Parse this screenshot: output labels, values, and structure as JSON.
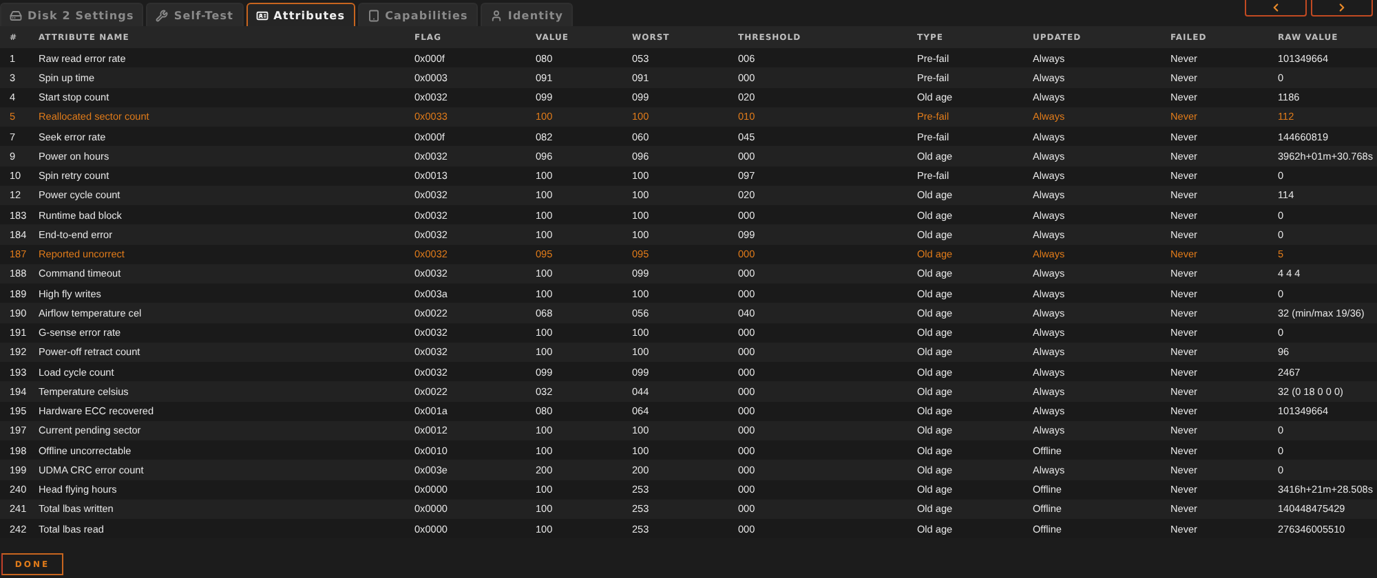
{
  "tabs": [
    {
      "label": "Disk 2 Settings",
      "selected": false
    },
    {
      "label": "Self-Test",
      "selected": false
    },
    {
      "label": "Attributes",
      "selected": true
    },
    {
      "label": "Capabilities",
      "selected": false
    },
    {
      "label": "Identity",
      "selected": false
    }
  ],
  "table": {
    "columns": [
      "#",
      "ATTRIBUTE NAME",
      "FLAG",
      "VALUE",
      "WORST",
      "THRESHOLD",
      "TYPE",
      "UPDATED",
      "FAILED",
      "RAW VALUE"
    ],
    "rows": [
      {
        "cells": [
          "1",
          "Raw read error rate",
          "0x000f",
          "080",
          "053",
          "006",
          "Pre-fail",
          "Always",
          "Never",
          "101349664"
        ],
        "warning": false
      },
      {
        "cells": [
          "3",
          "Spin up time",
          "0x0003",
          "091",
          "091",
          "000",
          "Pre-fail",
          "Always",
          "Never",
          "0"
        ],
        "warning": false
      },
      {
        "cells": [
          "4",
          "Start stop count",
          "0x0032",
          "099",
          "099",
          "020",
          "Old age",
          "Always",
          "Never",
          "1186"
        ],
        "warning": false
      },
      {
        "cells": [
          "5",
          "Reallocated sector count",
          "0x0033",
          "100",
          "100",
          "010",
          "Pre-fail",
          "Always",
          "Never",
          "112"
        ],
        "warning": true
      },
      {
        "cells": [
          "7",
          "Seek error rate",
          "0x000f",
          "082",
          "060",
          "045",
          "Pre-fail",
          "Always",
          "Never",
          "144660819"
        ],
        "warning": false
      },
      {
        "cells": [
          "9",
          "Power on hours",
          "0x0032",
          "096",
          "096",
          "000",
          "Old age",
          "Always",
          "Never",
          "3962h+01m+30.768s"
        ],
        "warning": false
      },
      {
        "cells": [
          "10",
          "Spin retry count",
          "0x0013",
          "100",
          "100",
          "097",
          "Pre-fail",
          "Always",
          "Never",
          "0"
        ],
        "warning": false
      },
      {
        "cells": [
          "12",
          "Power cycle count",
          "0x0032",
          "100",
          "100",
          "020",
          "Old age",
          "Always",
          "Never",
          "114"
        ],
        "warning": false
      },
      {
        "cells": [
          "183",
          "Runtime bad block",
          "0x0032",
          "100",
          "100",
          "000",
          "Old age",
          "Always",
          "Never",
          "0"
        ],
        "warning": false
      },
      {
        "cells": [
          "184",
          "End-to-end error",
          "0x0032",
          "100",
          "100",
          "099",
          "Old age",
          "Always",
          "Never",
          "0"
        ],
        "warning": false
      },
      {
        "cells": [
          "187",
          "Reported uncorrect",
          "0x0032",
          "095",
          "095",
          "000",
          "Old age",
          "Always",
          "Never",
          "5"
        ],
        "warning": true
      },
      {
        "cells": [
          "188",
          "Command timeout",
          "0x0032",
          "100",
          "099",
          "000",
          "Old age",
          "Always",
          "Never",
          "4 4 4"
        ],
        "warning": false
      },
      {
        "cells": [
          "189",
          "High fly writes",
          "0x003a",
          "100",
          "100",
          "000",
          "Old age",
          "Always",
          "Never",
          "0"
        ],
        "warning": false
      },
      {
        "cells": [
          "190",
          "Airflow temperature cel",
          "0x0022",
          "068",
          "056",
          "040",
          "Old age",
          "Always",
          "Never",
          "32 (min/max 19/36)"
        ],
        "warning": false
      },
      {
        "cells": [
          "191",
          "G-sense error rate",
          "0x0032",
          "100",
          "100",
          "000",
          "Old age",
          "Always",
          "Never",
          "0"
        ],
        "warning": false
      },
      {
        "cells": [
          "192",
          "Power-off retract count",
          "0x0032",
          "100",
          "100",
          "000",
          "Old age",
          "Always",
          "Never",
          "96"
        ],
        "warning": false
      },
      {
        "cells": [
          "193",
          "Load cycle count",
          "0x0032",
          "099",
          "099",
          "000",
          "Old age",
          "Always",
          "Never",
          "2467"
        ],
        "warning": false
      },
      {
        "cells": [
          "194",
          "Temperature celsius",
          "0x0022",
          "032",
          "044",
          "000",
          "Old age",
          "Always",
          "Never",
          "32 (0 18 0 0 0)"
        ],
        "warning": false
      },
      {
        "cells": [
          "195",
          "Hardware ECC recovered",
          "0x001a",
          "080",
          "064",
          "000",
          "Old age",
          "Always",
          "Never",
          "101349664"
        ],
        "warning": false
      },
      {
        "cells": [
          "197",
          "Current pending sector",
          "0x0012",
          "100",
          "100",
          "000",
          "Old age",
          "Always",
          "Never",
          "0"
        ],
        "warning": false
      },
      {
        "cells": [
          "198",
          "Offline uncorrectable",
          "0x0010",
          "100",
          "100",
          "000",
          "Old age",
          "Offline",
          "Never",
          "0"
        ],
        "warning": false
      },
      {
        "cells": [
          "199",
          "UDMA CRC error count",
          "0x003e",
          "200",
          "200",
          "000",
          "Old age",
          "Always",
          "Never",
          "0"
        ],
        "warning": false
      },
      {
        "cells": [
          "240",
          "Head flying hours",
          "0x0000",
          "100",
          "253",
          "000",
          "Old age",
          "Offline",
          "Never",
          "3416h+21m+28.508s"
        ],
        "warning": false
      },
      {
        "cells": [
          "241",
          "Total lbas written",
          "0x0000",
          "100",
          "253",
          "000",
          "Old age",
          "Offline",
          "Never",
          "140448475429"
        ],
        "warning": false
      },
      {
        "cells": [
          "242",
          "Total lbas read",
          "0x0000",
          "100",
          "253",
          "000",
          "Old age",
          "Offline",
          "Never",
          "276346005510"
        ],
        "warning": false
      }
    ]
  },
  "done_button": "DONE"
}
